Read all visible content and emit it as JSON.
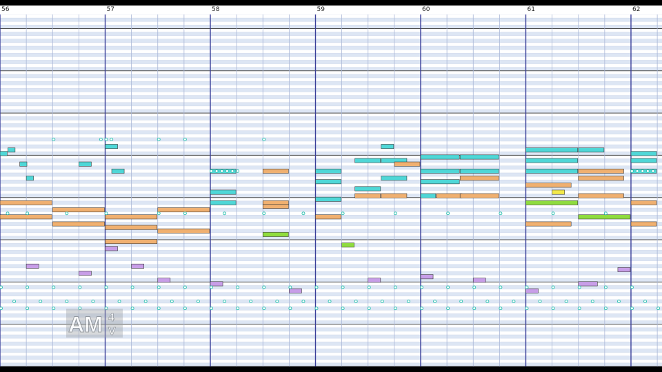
{
  "window": {
    "title": ""
  },
  "ruler": {
    "bars": [
      "56",
      "57",
      "58",
      "59",
      "60",
      "61",
      "62"
    ]
  },
  "watermark": {
    "text": "AM",
    "superscript": "4",
    "subscript": "V"
  },
  "colors": {
    "background": "#ffffff",
    "row_stripe": "#dde6f4",
    "octave_line": "#4a4a4a",
    "bar_line": "#3a3f99",
    "beat_line": "#a9b6d6",
    "note_cyan": "#4fd7d7",
    "note_orange": "#f0b070",
    "note_purple": "#c89ee8",
    "note_green": "#8fdc3e",
    "note_yellow": "#f2e84a",
    "note_outline": "#3a3a3a",
    "drum_hit": "#34c4b4"
  },
  "view": {
    "bars_visible": 7,
    "beats_per_bar": 4,
    "pitch_rows": 100,
    "octave_every_rows": 12
  },
  "notes": [
    {
      "beat": 0.0,
      "len": 2.0,
      "pitch": 46,
      "color": "orange"
    },
    {
      "beat": 0.0,
      "len": 2.0,
      "pitch": 42,
      "color": "orange"
    },
    {
      "beat": 2.0,
      "len": 2.0,
      "pitch": 44,
      "color": "orange"
    },
    {
      "beat": 2.0,
      "len": 2.0,
      "pitch": 40,
      "color": "orange"
    },
    {
      "beat": 4.0,
      "len": 2.0,
      "pitch": 42,
      "color": "orange"
    },
    {
      "beat": 4.0,
      "len": 2.0,
      "pitch": 39,
      "color": "orange"
    },
    {
      "beat": 6.0,
      "len": 2.0,
      "pitch": 44,
      "color": "orange"
    },
    {
      "beat": 6.0,
      "len": 2.0,
      "pitch": 38,
      "color": "orange"
    },
    {
      "beat": 4.0,
      "len": 2.0,
      "pitch": 35,
      "color": "orange"
    },
    {
      "beat": 0.0,
      "len": 0.3,
      "pitch": 60,
      "color": "cyan"
    },
    {
      "beat": 0.3,
      "len": 0.3,
      "pitch": 61,
      "color": "cyan"
    },
    {
      "beat": 0.75,
      "len": 0.3,
      "pitch": 57,
      "color": "cyan"
    },
    {
      "beat": 1.0,
      "len": 0.3,
      "pitch": 53,
      "color": "cyan"
    },
    {
      "beat": 3.0,
      "len": 0.5,
      "pitch": 57,
      "color": "cyan"
    },
    {
      "beat": 4.0,
      "len": 0.5,
      "pitch": 62,
      "color": "cyan"
    },
    {
      "beat": 4.25,
      "len": 0.5,
      "pitch": 55,
      "color": "cyan"
    },
    {
      "beat": 8.0,
      "len": 1.0,
      "pitch": 55,
      "color": "cyan"
    },
    {
      "beat": 8.0,
      "len": 1.0,
      "pitch": 49,
      "color": "cyan"
    },
    {
      "beat": 8.0,
      "len": 1.0,
      "pitch": 46,
      "color": "cyan"
    },
    {
      "beat": 10.0,
      "len": 1.0,
      "pitch": 55,
      "color": "orange"
    },
    {
      "beat": 10.0,
      "len": 1.0,
      "pitch": 46,
      "color": "orange"
    },
    {
      "beat": 10.0,
      "len": 1.0,
      "pitch": 45,
      "color": "orange"
    },
    {
      "beat": 12.0,
      "len": 1.0,
      "pitch": 55,
      "color": "cyan"
    },
    {
      "beat": 12.0,
      "len": 1.0,
      "pitch": 52,
      "color": "cyan"
    },
    {
      "beat": 12.0,
      "len": 1.0,
      "pitch": 47,
      "color": "cyan"
    },
    {
      "beat": 12.0,
      "len": 1.0,
      "pitch": 42,
      "color": "orange"
    },
    {
      "beat": 13.5,
      "len": 1.0,
      "pitch": 58,
      "color": "cyan"
    },
    {
      "beat": 13.5,
      "len": 1.0,
      "pitch": 50,
      "color": "cyan"
    },
    {
      "beat": 13.5,
      "len": 1.0,
      "pitch": 48,
      "color": "orange"
    },
    {
      "beat": 14.5,
      "len": 0.5,
      "pitch": 62,
      "color": "cyan"
    },
    {
      "beat": 14.5,
      "len": 1.0,
      "pitch": 58,
      "color": "cyan"
    },
    {
      "beat": 14.5,
      "len": 1.0,
      "pitch": 53,
      "color": "cyan"
    },
    {
      "beat": 15.0,
      "len": 1.0,
      "pitch": 57,
      "color": "orange"
    },
    {
      "beat": 14.5,
      "len": 1.0,
      "pitch": 48,
      "color": "orange"
    },
    {
      "beat": 16.0,
      "len": 1.5,
      "pitch": 59,
      "color": "cyan"
    },
    {
      "beat": 16.0,
      "len": 1.5,
      "pitch": 55,
      "color": "cyan"
    },
    {
      "beat": 16.0,
      "len": 1.5,
      "pitch": 52,
      "color": "cyan"
    },
    {
      "beat": 16.0,
      "len": 0.6,
      "pitch": 48,
      "color": "cyan"
    },
    {
      "beat": 16.6,
      "len": 1.0,
      "pitch": 48,
      "color": "orange"
    },
    {
      "beat": 17.5,
      "len": 1.5,
      "pitch": 59,
      "color": "cyan"
    },
    {
      "beat": 17.5,
      "len": 1.5,
      "pitch": 55,
      "color": "cyan"
    },
    {
      "beat": 17.5,
      "len": 1.5,
      "pitch": 53,
      "color": "orange"
    },
    {
      "beat": 17.5,
      "len": 1.5,
      "pitch": 48,
      "color": "orange"
    },
    {
      "beat": 20.0,
      "len": 2.0,
      "pitch": 61,
      "color": "cyan"
    },
    {
      "beat": 20.0,
      "len": 2.0,
      "pitch": 58,
      "color": "cyan"
    },
    {
      "beat": 20.0,
      "len": 2.0,
      "pitch": 55,
      "color": "cyan"
    },
    {
      "beat": 20.0,
      "len": 1.75,
      "pitch": 51,
      "color": "orange"
    },
    {
      "beat": 20.0,
      "len": 2.0,
      "pitch": 46,
      "color": "green"
    },
    {
      "beat": 20.0,
      "len": 1.75,
      "pitch": 40,
      "color": "orange"
    },
    {
      "beat": 22.0,
      "len": 1.0,
      "pitch": 61,
      "color": "cyan"
    },
    {
      "beat": 22.0,
      "len": 1.75,
      "pitch": 55,
      "color": "orange"
    },
    {
      "beat": 22.0,
      "len": 1.75,
      "pitch": 53,
      "color": "orange"
    },
    {
      "beat": 22.0,
      "len": 1.75,
      "pitch": 48,
      "color": "orange"
    },
    {
      "beat": 22.0,
      "len": 2.0,
      "pitch": 42,
      "color": "green"
    },
    {
      "beat": 24.0,
      "len": 1.0,
      "pitch": 60,
      "color": "cyan"
    },
    {
      "beat": 24.0,
      "len": 1.0,
      "pitch": 58,
      "color": "cyan"
    },
    {
      "beat": 24.0,
      "len": 1.0,
      "pitch": 55,
      "color": "cyan"
    },
    {
      "beat": 24.0,
      "len": 1.0,
      "pitch": 46,
      "color": "orange"
    },
    {
      "beat": 24.0,
      "len": 1.0,
      "pitch": 40,
      "color": "orange"
    },
    {
      "beat": 1.0,
      "len": 0.5,
      "pitch": 28,
      "color": "purple"
    },
    {
      "beat": 3.0,
      "len": 0.5,
      "pitch": 26,
      "color": "purple"
    },
    {
      "beat": 5.0,
      "len": 0.5,
      "pitch": 28,
      "color": "purple"
    },
    {
      "beat": 6.0,
      "len": 0.5,
      "pitch": 24,
      "color": "purple"
    },
    {
      "beat": 8.0,
      "len": 0.5,
      "pitch": 23,
      "color": "purple"
    },
    {
      "beat": 11.0,
      "len": 0.5,
      "pitch": 21,
      "color": "purple"
    },
    {
      "beat": 14.0,
      "len": 0.5,
      "pitch": 24,
      "color": "purple"
    },
    {
      "beat": 16.0,
      "len": 0.5,
      "pitch": 25,
      "color": "purple"
    },
    {
      "beat": 18.0,
      "len": 0.5,
      "pitch": 24,
      "color": "purple"
    },
    {
      "beat": 20.0,
      "len": 0.5,
      "pitch": 21,
      "color": "purple"
    },
    {
      "beat": 22.0,
      "len": 0.75,
      "pitch": 23,
      "color": "purple"
    },
    {
      "beat": 23.5,
      "len": 0.5,
      "pitch": 27,
      "color": "purple"
    },
    {
      "beat": 4.0,
      "len": 0.5,
      "pitch": 33,
      "color": "purple"
    },
    {
      "beat": 10.0,
      "len": 1.0,
      "pitch": 37,
      "color": "green"
    },
    {
      "beat": 13.0,
      "len": 0.5,
      "pitch": 34,
      "color": "green"
    },
    {
      "beat": 21.0,
      "len": 0.5,
      "pitch": 49,
      "color": "yellow"
    }
  ],
  "drum_hits": [
    {
      "beat": 2.0,
      "pitch": 64
    },
    {
      "beat": 3.8,
      "pitch": 64
    },
    {
      "beat": 4.0,
      "pitch": 64
    },
    {
      "beat": 4.2,
      "pitch": 64
    },
    {
      "beat": 6.0,
      "pitch": 64
    },
    {
      "beat": 7.0,
      "pitch": 64
    },
    {
      "beat": 10.0,
      "pitch": 64
    },
    {
      "beat": 8.0,
      "pitch": 55
    },
    {
      "beat": 8.2,
      "pitch": 55
    },
    {
      "beat": 8.4,
      "pitch": 55
    },
    {
      "beat": 8.6,
      "pitch": 55
    },
    {
      "beat": 8.8,
      "pitch": 55
    },
    {
      "beat": 9.0,
      "pitch": 55
    },
    {
      "beat": 24.0,
      "pitch": 55
    },
    {
      "beat": 24.2,
      "pitch": 55
    },
    {
      "beat": 24.4,
      "pitch": 55
    },
    {
      "beat": 24.6,
      "pitch": 55
    },
    {
      "beat": 24.8,
      "pitch": 55
    },
    {
      "beat": 0.25,
      "pitch": 43
    },
    {
      "beat": 1.0,
      "pitch": 43
    },
    {
      "beat": 2.5,
      "pitch": 43
    },
    {
      "beat": 4.0,
      "pitch": 43
    },
    {
      "beat": 6.0,
      "pitch": 43
    },
    {
      "beat": 7.0,
      "pitch": 43
    },
    {
      "beat": 8.5,
      "pitch": 43
    },
    {
      "beat": 10.0,
      "pitch": 43
    },
    {
      "beat": 11.5,
      "pitch": 43
    },
    {
      "beat": 13.0,
      "pitch": 43
    },
    {
      "beat": 15.0,
      "pitch": 43
    },
    {
      "beat": 17.0,
      "pitch": 43
    },
    {
      "beat": 19.0,
      "pitch": 43
    },
    {
      "beat": 21.0,
      "pitch": 43
    },
    {
      "beat": 23.0,
      "pitch": 43
    },
    {
      "beat": 0.0,
      "pitch": 22
    },
    {
      "beat": 0.5,
      "pitch": 18
    },
    {
      "beat": 1.0,
      "pitch": 22
    },
    {
      "beat": 1.5,
      "pitch": 18
    },
    {
      "beat": 2.0,
      "pitch": 22
    },
    {
      "beat": 2.5,
      "pitch": 18
    },
    {
      "beat": 3.0,
      "pitch": 22
    },
    {
      "beat": 3.5,
      "pitch": 18
    },
    {
      "beat": 4.0,
      "pitch": 22
    },
    {
      "beat": 4.5,
      "pitch": 18
    },
    {
      "beat": 5.0,
      "pitch": 22
    },
    {
      "beat": 5.5,
      "pitch": 18
    },
    {
      "beat": 6.0,
      "pitch": 22
    },
    {
      "beat": 6.5,
      "pitch": 18
    },
    {
      "beat": 7.0,
      "pitch": 22
    },
    {
      "beat": 7.5,
      "pitch": 18
    },
    {
      "beat": 8.0,
      "pitch": 22
    },
    {
      "beat": 8.5,
      "pitch": 18
    },
    {
      "beat": 9.0,
      "pitch": 22
    },
    {
      "beat": 9.5,
      "pitch": 18
    },
    {
      "beat": 10.0,
      "pitch": 22
    },
    {
      "beat": 10.5,
      "pitch": 18
    },
    {
      "beat": 11.0,
      "pitch": 22
    },
    {
      "beat": 11.5,
      "pitch": 18
    },
    {
      "beat": 12.0,
      "pitch": 22
    },
    {
      "beat": 12.5,
      "pitch": 18
    },
    {
      "beat": 13.0,
      "pitch": 22
    },
    {
      "beat": 13.5,
      "pitch": 18
    },
    {
      "beat": 14.0,
      "pitch": 22
    },
    {
      "beat": 14.5,
      "pitch": 18
    },
    {
      "beat": 15.0,
      "pitch": 22
    },
    {
      "beat": 15.5,
      "pitch": 18
    },
    {
      "beat": 16.0,
      "pitch": 22
    },
    {
      "beat": 16.5,
      "pitch": 18
    },
    {
      "beat": 17.0,
      "pitch": 22
    },
    {
      "beat": 17.5,
      "pitch": 18
    },
    {
      "beat": 18.0,
      "pitch": 22
    },
    {
      "beat": 18.5,
      "pitch": 18
    },
    {
      "beat": 19.0,
      "pitch": 22
    },
    {
      "beat": 19.5,
      "pitch": 18
    },
    {
      "beat": 20.0,
      "pitch": 22
    },
    {
      "beat": 20.5,
      "pitch": 18
    },
    {
      "beat": 21.0,
      "pitch": 22
    },
    {
      "beat": 21.5,
      "pitch": 18
    },
    {
      "beat": 22.0,
      "pitch": 22
    },
    {
      "beat": 22.5,
      "pitch": 18
    },
    {
      "beat": 23.0,
      "pitch": 22
    },
    {
      "beat": 23.5,
      "pitch": 18
    },
    {
      "beat": 24.0,
      "pitch": 22
    },
    {
      "beat": 24.5,
      "pitch": 18
    },
    {
      "beat": 0.0,
      "pitch": 16
    },
    {
      "beat": 1.0,
      "pitch": 16
    },
    {
      "beat": 2.0,
      "pitch": 16
    },
    {
      "beat": 3.0,
      "pitch": 16
    },
    {
      "beat": 4.0,
      "pitch": 16
    },
    {
      "beat": 5.0,
      "pitch": 16
    },
    {
      "beat": 6.0,
      "pitch": 16
    },
    {
      "beat": 7.0,
      "pitch": 16
    },
    {
      "beat": 8.0,
      "pitch": 16
    },
    {
      "beat": 9.0,
      "pitch": 16
    },
    {
      "beat": 10.0,
      "pitch": 16
    },
    {
      "beat": 11.0,
      "pitch": 16
    },
    {
      "beat": 12.0,
      "pitch": 16
    },
    {
      "beat": 13.0,
      "pitch": 16
    },
    {
      "beat": 14.0,
      "pitch": 16
    },
    {
      "beat": 15.0,
      "pitch": 16
    },
    {
      "beat": 16.0,
      "pitch": 16
    },
    {
      "beat": 17.0,
      "pitch": 16
    },
    {
      "beat": 18.0,
      "pitch": 16
    },
    {
      "beat": 19.0,
      "pitch": 16
    },
    {
      "beat": 20.0,
      "pitch": 16
    },
    {
      "beat": 21.0,
      "pitch": 16
    },
    {
      "beat": 22.0,
      "pitch": 16
    },
    {
      "beat": 23.0,
      "pitch": 16
    },
    {
      "beat": 24.0,
      "pitch": 16
    },
    {
      "beat": 25.0,
      "pitch": 16
    }
  ]
}
